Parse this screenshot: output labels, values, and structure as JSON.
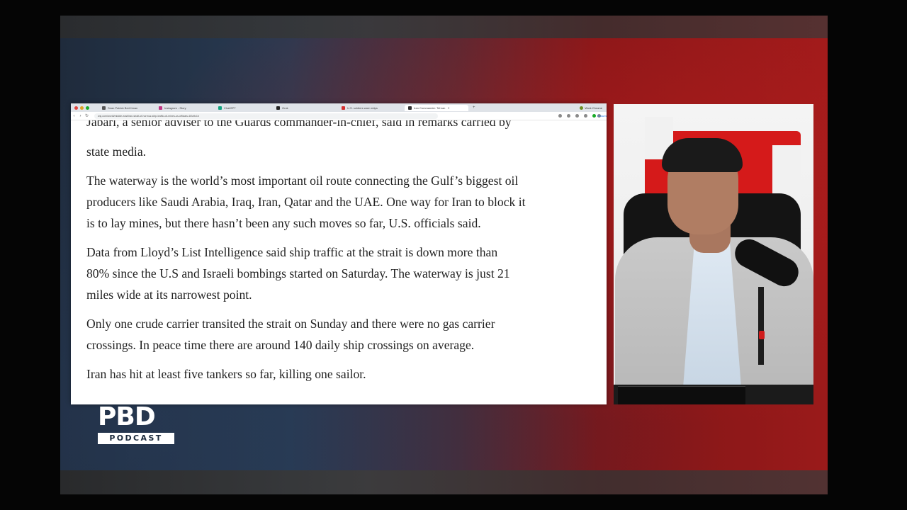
{
  "browser": {
    "tabs": [
      {
        "label": "Sean Patrick Bert Kwan",
        "active": false
      },
      {
        "label": "Instagram - Story",
        "active": false
      },
      {
        "label": "ChatGPT",
        "active": false
      },
      {
        "label": "Grok",
        "active": false
      },
      {
        "label": "U.S. soldiers warn ships",
        "active": false
      },
      {
        "label": "Iran Commander: Tehran",
        "active": true
      }
    ],
    "new_tab": "+",
    "profile": "Work Chrome",
    "url": "wsj.com/world/middle-east/iran-strait-of-hormuz-ship-traffic-oil-mines-us-officials-4f2a9c1b",
    "resume_label": "Resume"
  },
  "article": {
    "partial_line": "Jabari, a senior adviser to the Guards commander-in-chief, said in remarks carried by",
    "paragraphs": [
      {
        "lines": [
          "state media."
        ]
      },
      {
        "lines": [
          "The waterway is the world’s most important oil route connecting the Gulf’s biggest oil",
          "producers like Saudi Arabia, Iraq, Iran, Qatar and the UAE. One way for Iran to block it",
          "is to lay mines, but there hasn’t been any such moves so far, U.S. officials said."
        ]
      },
      {
        "lines": [
          "Data from Lloyd’s List Intelligence said ship traffic at the strait is down more than",
          "80% since the U.S and Israeli bombings started on Saturday. The waterway is just 21",
          "miles wide at its narrowest point."
        ]
      },
      {
        "lines": [
          "Only one crude carrier transited the strait on Sunday and there were no gas carrier",
          "crossings. In peace time there are around 140 daily ship crossings on average."
        ]
      },
      {
        "lines": [
          "Iran has hit at least five tankers so far, killing one sailor."
        ]
      }
    ]
  },
  "logo": {
    "main": "PBD",
    "sub": "PODCAST"
  },
  "colors": {
    "accent_red": "#9a1a1a",
    "navy": "#1f2b3c"
  }
}
